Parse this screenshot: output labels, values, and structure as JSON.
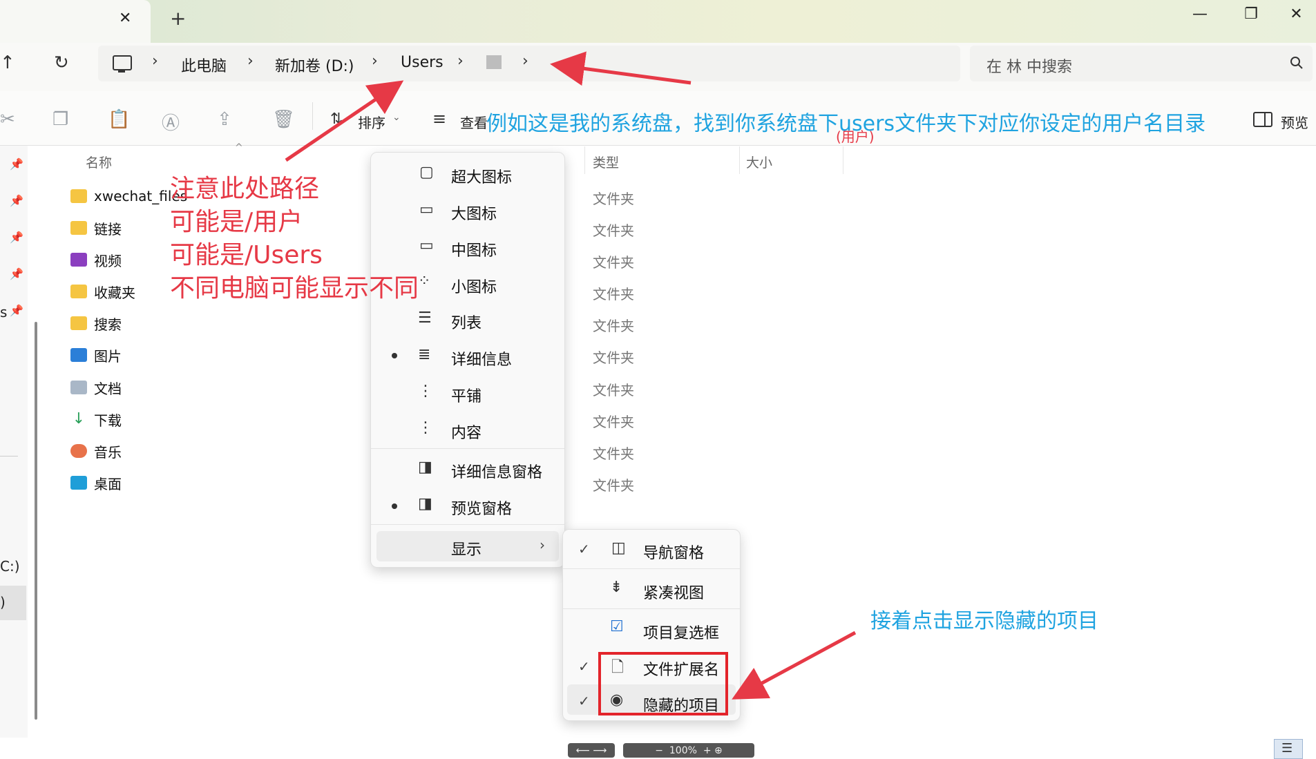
{
  "window": {
    "tab_close": "✕",
    "new_tab": "+",
    "minimize": "—",
    "restore": "❐",
    "close": "✕"
  },
  "nav": {
    "up": "↑",
    "refresh": "↻"
  },
  "breadcrumb": {
    "items": [
      "此电脑",
      "新加卷 (D:)",
      "Users"
    ],
    "separator": "›"
  },
  "search": {
    "placeholder": "在 林 中搜索"
  },
  "commandbar": {
    "sort_label": "排序",
    "view_label": "查看",
    "preview_label": "预览"
  },
  "columns": {
    "name": "名称",
    "type": "类型",
    "size": "大小"
  },
  "files": [
    {
      "name": "xwechat_files",
      "type": "文件夹",
      "icon": "folder-icon"
    },
    {
      "name": "链接",
      "type": "文件夹",
      "icon": "folder-icon"
    },
    {
      "name": "视频",
      "type": "文件夹",
      "icon": "video-folder-icon"
    },
    {
      "name": "收藏夹",
      "type": "文件夹",
      "icon": "folder-icon"
    },
    {
      "name": "搜索",
      "type": "文件夹",
      "icon": "folder-icon"
    },
    {
      "name": "图片",
      "type": "文件夹",
      "icon": "pictures-folder-icon"
    },
    {
      "name": "文档",
      "type": "文件夹",
      "icon": "documents-folder-icon"
    },
    {
      "name": "下载",
      "type": "文件夹",
      "icon": "downloads-folder-icon"
    },
    {
      "name": "音乐",
      "type": "文件夹",
      "icon": "music-folder-icon"
    },
    {
      "name": "桌面",
      "type": "文件夹",
      "icon": "desktop-folder-icon"
    }
  ],
  "left_drives": {
    "c_label": "C:)",
    "other_label": ")",
    "s_label": "s"
  },
  "view_menu": {
    "items": [
      "超大图标",
      "大图标",
      "中图标",
      "小图标",
      "列表",
      "详细信息",
      "平铺",
      "内容"
    ],
    "pane_items": [
      "详细信息窗格",
      "预览窗格"
    ],
    "show_label": "显示"
  },
  "show_menu": {
    "items": [
      "导航窗格",
      "紧凑视图",
      "项目复选框",
      "文件扩展名",
      "隐藏的项目"
    ]
  },
  "annotations": {
    "top_note": "例如这是我的系统盘，找到你系统盘下users文件夹下对应你设定的用户名目录",
    "top_note_sub": "(用户)",
    "path_note": [
      "注意此处路径",
      "可能是/用户",
      "可能是/Users",
      "不同电脑可能显示不同"
    ],
    "hidden_note": "接着点击显示隐藏的项目"
  },
  "bottom": {
    "zoom": "100%"
  },
  "colors": {
    "annotation_red": "#e63946",
    "annotation_blue": "#1fa3e0",
    "highlight_red": "#e3242b",
    "folder_yellow": "#f5c542"
  }
}
